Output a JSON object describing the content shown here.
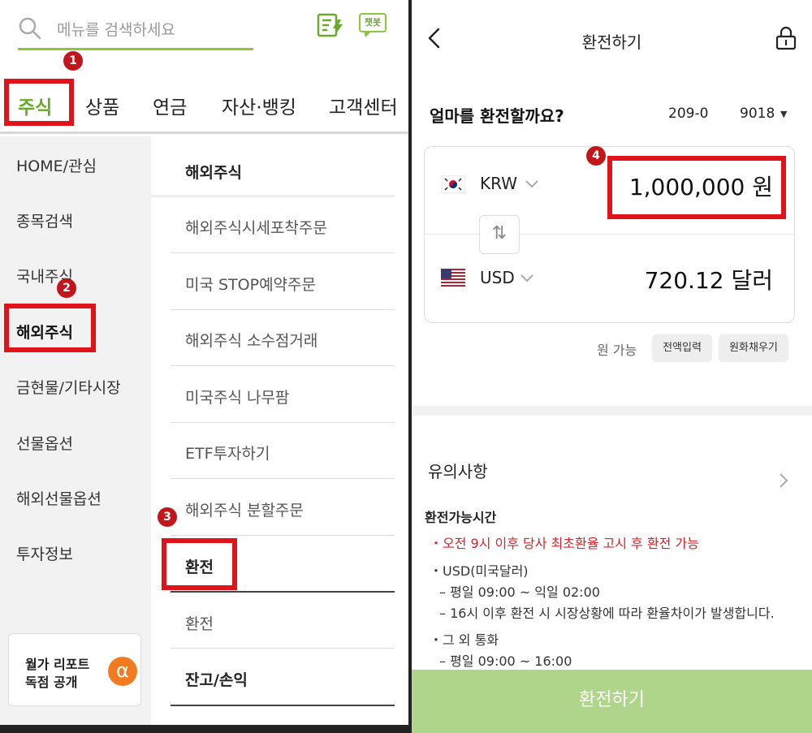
{
  "left": {
    "search": {
      "placeholder": "메뉴를 검색하세요"
    },
    "chatbot_label": "챗봇",
    "badges": {
      "b1": "1",
      "b2": "2",
      "b3": "3",
      "b4": "4"
    },
    "tabs": [
      {
        "label": "주식"
      },
      {
        "label": "상품"
      },
      {
        "label": "연금"
      },
      {
        "label": "자산·뱅킹"
      },
      {
        "label": "고객센터"
      }
    ],
    "side_menu": [
      {
        "label": "HOME/관심"
      },
      {
        "label": "종목검색"
      },
      {
        "label": "국내주식"
      },
      {
        "label": "해외주식"
      },
      {
        "label": "금현물/기타시장"
      },
      {
        "label": "선물옵션"
      },
      {
        "label": "해외선물옵션"
      },
      {
        "label": "투자정보"
      }
    ],
    "promo": {
      "line1": "월가 리포트",
      "line2": "독점 공개",
      "symbol": "α"
    },
    "sub_menu": {
      "section1": "해외주식",
      "items": [
        "해외주식시세포착주문",
        "미국 STOP예약주문",
        "해외주식 소수점거래",
        "미국주식 나무팜",
        "ETF투자하기",
        "해외주식 분할주문"
      ],
      "section2": "환전",
      "section2_items": [
        "환전"
      ],
      "section3": "잔고/손익"
    }
  },
  "right": {
    "title": "환전하기",
    "question": "얼마를 환전할까요?",
    "account": {
      "number": "209-0",
      "suffix": "9018"
    },
    "from": {
      "code": "KRW",
      "amount": "1,000,000 원"
    },
    "to": {
      "code": "USD",
      "amount": "720.12 달러"
    },
    "swap_symbol": "⇅",
    "available_text": "원 가능",
    "chips": {
      "all": "전액입력",
      "fill": "원화채우기"
    },
    "notice": {
      "title": "유의사항",
      "hours_title": "환전가능시간",
      "lines": [
        "・오전 9시 이후 당사 최초환율 고시 후 환전 가능",
        "・USD(미국달러)",
        "– 평일 09:00 ~ 익일 02:00",
        "– 16시 이후 환전 시 시장상황에 따라 환율차이가 발생합니다.",
        "・그 외 통화",
        "– 평일 09:00 ~ 16:00"
      ]
    },
    "cta": "환전하기"
  },
  "colors": {
    "accent_green": "#8cc63f",
    "highlight_red": "#e0121a",
    "cta_green": "#aed58a",
    "notice_red": "#d9232a"
  }
}
